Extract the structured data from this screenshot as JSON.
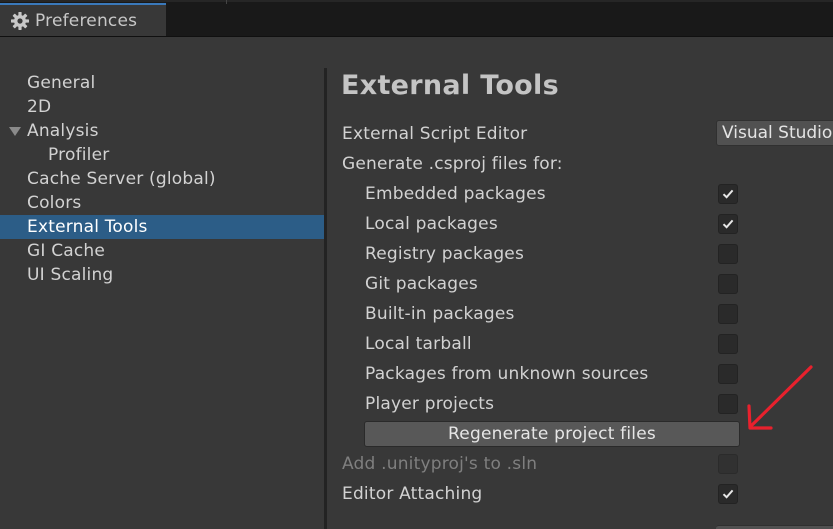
{
  "window": {
    "tab_title": "Preferences"
  },
  "sidebar": {
    "items": [
      {
        "label": "General"
      },
      {
        "label": "2D"
      },
      {
        "label": "Analysis"
      },
      {
        "label": "Profiler"
      },
      {
        "label": "Cache Server (global)"
      },
      {
        "label": "Colors"
      },
      {
        "label": "External Tools"
      },
      {
        "label": "GI Cache"
      },
      {
        "label": "UI Scaling"
      }
    ],
    "selected": "External Tools"
  },
  "main": {
    "title": "External Tools",
    "external_script_editor": {
      "label": "External Script Editor",
      "value": "Visual Studio"
    },
    "generate_label": "Generate .csproj files for:",
    "options": [
      {
        "label": "Embedded packages",
        "checked": true
      },
      {
        "label": "Local packages",
        "checked": true
      },
      {
        "label": "Registry packages",
        "checked": false
      },
      {
        "label": "Git packages",
        "checked": false
      },
      {
        "label": "Built-in packages",
        "checked": false
      },
      {
        "label": "Local tarball",
        "checked": false
      },
      {
        "label": "Packages from unknown sources",
        "checked": false
      },
      {
        "label": "Player projects",
        "checked": false
      }
    ],
    "regenerate_button": "Regenerate project files",
    "add_unityproj": {
      "label": "Add .unityproj's to .sln",
      "checked": false,
      "disabled": true
    },
    "editor_attaching": {
      "label": "Editor Attaching",
      "checked": true
    }
  },
  "colors": {
    "accent_tab": "#3a79bb",
    "selection": "#2c5d87",
    "annotation_arrow": "#e8212d"
  },
  "icons": {
    "tab_icon": "gear-icon",
    "foldout_icon": "triangle-down-icon",
    "check_icon": "checkmark-icon",
    "annotation": "red-arrow-icon"
  }
}
